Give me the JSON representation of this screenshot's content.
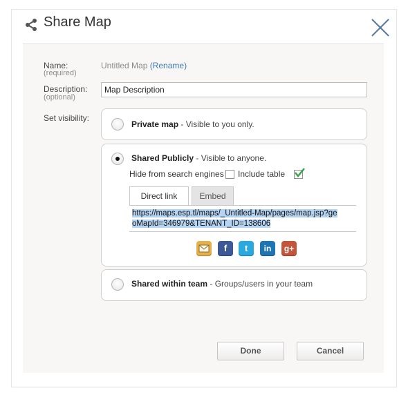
{
  "dialog": {
    "title": "Share Map"
  },
  "form": {
    "name_label": "Name:",
    "name_required": "(required)",
    "name_value": "Untitled Map",
    "rename_link": "(Rename)",
    "description_label": "Description:",
    "description_optional": "(optional)",
    "description_value": "Map Description",
    "visibility_label": "Set visibility:"
  },
  "options": {
    "private_title": "Private map",
    "private_desc": " - Visible to you only.",
    "public_title": "Shared Publicly",
    "public_desc": " - Visible to anyone.",
    "hide_search": "Hide from search engines",
    "include_table": "Include table",
    "team_title": "Shared within team",
    "team_desc": " - Groups/users in your team",
    "selected": "public"
  },
  "tabs": {
    "direct_link": "Direct link",
    "embed": "Embed",
    "active": "direct_link"
  },
  "share_link": {
    "url": "https://maps.esp.tl/maps/_Untitled-Map/pages/map.jsp?geoMapId=346979&TENANT_ID=138606"
  },
  "social": {
    "email": "email-icon",
    "facebook": "f",
    "twitter": "t",
    "linkedin": "in",
    "googleplus": "g+"
  },
  "buttons": {
    "done": "Done",
    "cancel": "Cancel"
  },
  "colors": {
    "link": "#3b78b4",
    "selection": "#b5d3f3",
    "facebook": "#3b5998",
    "twitter": "#2aa9e0",
    "linkedin": "#1d75b3",
    "googleplus": "#c4553a",
    "email": "#e8b04a"
  }
}
